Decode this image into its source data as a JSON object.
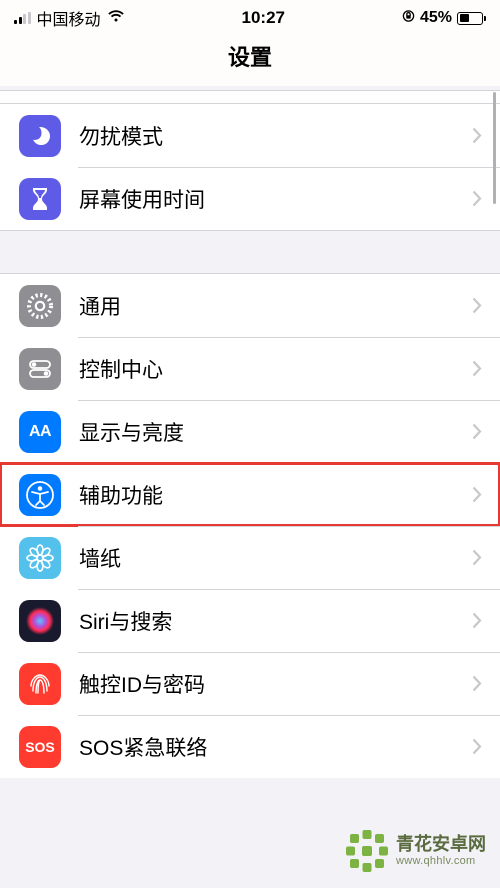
{
  "status_bar": {
    "carrier": "中国移动",
    "time": "10:27",
    "battery_percent": "45%"
  },
  "header": {
    "title": "设置"
  },
  "section1": [
    {
      "id": "dnd",
      "label": "勿扰模式"
    },
    {
      "id": "screentime",
      "label": "屏幕使用时间"
    }
  ],
  "section2": [
    {
      "id": "general",
      "label": "通用"
    },
    {
      "id": "control",
      "label": "控制中心"
    },
    {
      "id": "display",
      "label": "显示与亮度"
    },
    {
      "id": "accessibility",
      "label": "辅助功能",
      "highlighted": true
    },
    {
      "id": "wallpaper",
      "label": "墙纸"
    },
    {
      "id": "siri",
      "label": "Siri与搜索"
    },
    {
      "id": "touchid",
      "label": "触控ID与密码"
    },
    {
      "id": "sos",
      "label": "SOS紧急联络"
    }
  ],
  "icons": {
    "display_text": "AA",
    "sos_text": "SOS"
  },
  "watermark": {
    "title": "青花安卓网",
    "url": "www.qhhlv.com"
  }
}
